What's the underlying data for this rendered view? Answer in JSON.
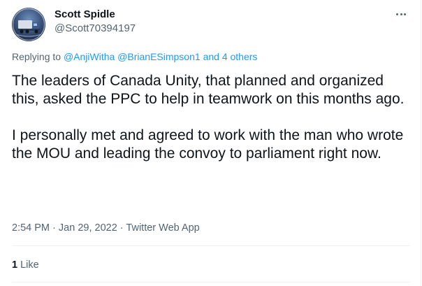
{
  "tweet": {
    "author": {
      "name": "Scott Spidle",
      "handle": "@Scott70394197",
      "avatar_icon": "truck-avatar-icon"
    },
    "reply": {
      "prefix": "Replying to",
      "mentions": [
        "@AnjiWitha",
        "@BrianESimpson1"
      ],
      "and_text": "and",
      "others": "4 others"
    },
    "paragraphs": [
      "The leaders of Canada Unity, that planned and organized this, asked the PPC to help in teamwork on this months ago.",
      "I personally met and agreed to work with the man who wrote the MOU and leading the convoy to parliament right now."
    ],
    "meta": {
      "time": "2:54 PM",
      "separator": "·",
      "date": "Jan 29, 2022",
      "source": "Twitter Web App"
    },
    "stats": {
      "likes_count": "1",
      "likes_label": "Like"
    }
  },
  "colors": {
    "link": "#1d9bf0",
    "secondary_text": "#536471",
    "primary_text": "#0f1419",
    "divider": "#eff3f4"
  }
}
